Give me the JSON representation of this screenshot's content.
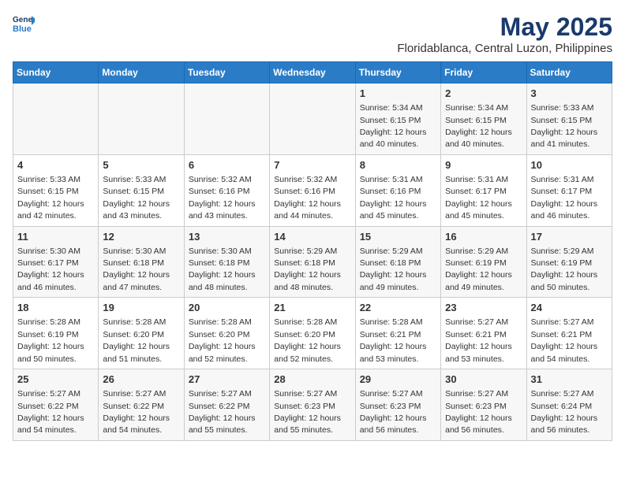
{
  "logo": {
    "line1": "General",
    "line2": "Blue"
  },
  "header": {
    "month_year": "May 2025",
    "location": "Floridablanca, Central Luzon, Philippines"
  },
  "weekdays": [
    "Sunday",
    "Monday",
    "Tuesday",
    "Wednesday",
    "Thursday",
    "Friday",
    "Saturday"
  ],
  "weeks": [
    [
      {
        "day": "",
        "info": ""
      },
      {
        "day": "",
        "info": ""
      },
      {
        "day": "",
        "info": ""
      },
      {
        "day": "",
        "info": ""
      },
      {
        "day": "1",
        "info": "Sunrise: 5:34 AM\nSunset: 6:15 PM\nDaylight: 12 hours\nand 40 minutes."
      },
      {
        "day": "2",
        "info": "Sunrise: 5:34 AM\nSunset: 6:15 PM\nDaylight: 12 hours\nand 40 minutes."
      },
      {
        "day": "3",
        "info": "Sunrise: 5:33 AM\nSunset: 6:15 PM\nDaylight: 12 hours\nand 41 minutes."
      }
    ],
    [
      {
        "day": "4",
        "info": "Sunrise: 5:33 AM\nSunset: 6:15 PM\nDaylight: 12 hours\nand 42 minutes."
      },
      {
        "day": "5",
        "info": "Sunrise: 5:33 AM\nSunset: 6:15 PM\nDaylight: 12 hours\nand 43 minutes."
      },
      {
        "day": "6",
        "info": "Sunrise: 5:32 AM\nSunset: 6:16 PM\nDaylight: 12 hours\nand 43 minutes."
      },
      {
        "day": "7",
        "info": "Sunrise: 5:32 AM\nSunset: 6:16 PM\nDaylight: 12 hours\nand 44 minutes."
      },
      {
        "day": "8",
        "info": "Sunrise: 5:31 AM\nSunset: 6:16 PM\nDaylight: 12 hours\nand 45 minutes."
      },
      {
        "day": "9",
        "info": "Sunrise: 5:31 AM\nSunset: 6:17 PM\nDaylight: 12 hours\nand 45 minutes."
      },
      {
        "day": "10",
        "info": "Sunrise: 5:31 AM\nSunset: 6:17 PM\nDaylight: 12 hours\nand 46 minutes."
      }
    ],
    [
      {
        "day": "11",
        "info": "Sunrise: 5:30 AM\nSunset: 6:17 PM\nDaylight: 12 hours\nand 46 minutes."
      },
      {
        "day": "12",
        "info": "Sunrise: 5:30 AM\nSunset: 6:18 PM\nDaylight: 12 hours\nand 47 minutes."
      },
      {
        "day": "13",
        "info": "Sunrise: 5:30 AM\nSunset: 6:18 PM\nDaylight: 12 hours\nand 48 minutes."
      },
      {
        "day": "14",
        "info": "Sunrise: 5:29 AM\nSunset: 6:18 PM\nDaylight: 12 hours\nand 48 minutes."
      },
      {
        "day": "15",
        "info": "Sunrise: 5:29 AM\nSunset: 6:18 PM\nDaylight: 12 hours\nand 49 minutes."
      },
      {
        "day": "16",
        "info": "Sunrise: 5:29 AM\nSunset: 6:19 PM\nDaylight: 12 hours\nand 49 minutes."
      },
      {
        "day": "17",
        "info": "Sunrise: 5:29 AM\nSunset: 6:19 PM\nDaylight: 12 hours\nand 50 minutes."
      }
    ],
    [
      {
        "day": "18",
        "info": "Sunrise: 5:28 AM\nSunset: 6:19 PM\nDaylight: 12 hours\nand 50 minutes."
      },
      {
        "day": "19",
        "info": "Sunrise: 5:28 AM\nSunset: 6:20 PM\nDaylight: 12 hours\nand 51 minutes."
      },
      {
        "day": "20",
        "info": "Sunrise: 5:28 AM\nSunset: 6:20 PM\nDaylight: 12 hours\nand 52 minutes."
      },
      {
        "day": "21",
        "info": "Sunrise: 5:28 AM\nSunset: 6:20 PM\nDaylight: 12 hours\nand 52 minutes."
      },
      {
        "day": "22",
        "info": "Sunrise: 5:28 AM\nSunset: 6:21 PM\nDaylight: 12 hours\nand 53 minutes."
      },
      {
        "day": "23",
        "info": "Sunrise: 5:27 AM\nSunset: 6:21 PM\nDaylight: 12 hours\nand 53 minutes."
      },
      {
        "day": "24",
        "info": "Sunrise: 5:27 AM\nSunset: 6:21 PM\nDaylight: 12 hours\nand 54 minutes."
      }
    ],
    [
      {
        "day": "25",
        "info": "Sunrise: 5:27 AM\nSunset: 6:22 PM\nDaylight: 12 hours\nand 54 minutes."
      },
      {
        "day": "26",
        "info": "Sunrise: 5:27 AM\nSunset: 6:22 PM\nDaylight: 12 hours\nand 54 minutes."
      },
      {
        "day": "27",
        "info": "Sunrise: 5:27 AM\nSunset: 6:22 PM\nDaylight: 12 hours\nand 55 minutes."
      },
      {
        "day": "28",
        "info": "Sunrise: 5:27 AM\nSunset: 6:23 PM\nDaylight: 12 hours\nand 55 minutes."
      },
      {
        "day": "29",
        "info": "Sunrise: 5:27 AM\nSunset: 6:23 PM\nDaylight: 12 hours\nand 56 minutes."
      },
      {
        "day": "30",
        "info": "Sunrise: 5:27 AM\nSunset: 6:23 PM\nDaylight: 12 hours\nand 56 minutes."
      },
      {
        "day": "31",
        "info": "Sunrise: 5:27 AM\nSunset: 6:24 PM\nDaylight: 12 hours\nand 56 minutes."
      }
    ]
  ]
}
